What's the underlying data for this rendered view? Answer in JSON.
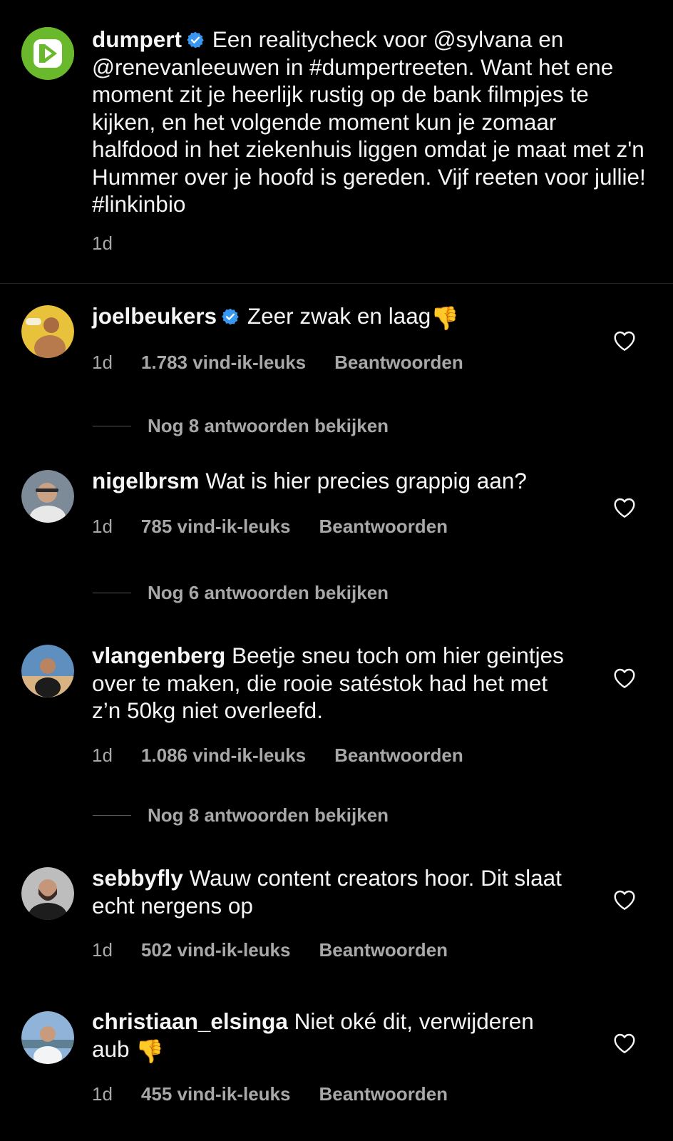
{
  "caption": {
    "username": "dumpert",
    "text": "Een realitycheck voor @sylvana en @renevanleeuwen in #dumpertreeten. Want het ene moment zit je heerlijk rustig op de bank filmpjes te kijken, en het volgende moment kun je zomaar halfdood in het ziekenhuis liggen omdat je maat met z'n Hummer over je hoofd is gereden. Vijf reeten voor jullie! #linkinbio",
    "time": "1d"
  },
  "comments": [
    {
      "username": "joelbeukers",
      "verified": true,
      "text": "Zeer zwak en laag",
      "emoji": "👎",
      "time": "1d",
      "likes": "1.783 vind-ik-leuks",
      "reply": "Beantwoorden",
      "view_replies": "Nog 8 antwoorden bekijken"
    },
    {
      "username": "nigelbrsm",
      "text": "Wat is hier precies grappig aan?",
      "time": "1d",
      "likes": "785 vind-ik-leuks",
      "reply": "Beantwoorden",
      "view_replies": "Nog 6 antwoorden bekijken"
    },
    {
      "username": "vlangenberg",
      "text": "Beetje sneu toch om hier geintjes over te maken, die rooie satéstok had het met z’n 50kg niet overleefd.",
      "time": "1d",
      "likes": "1.086 vind-ik-leuks",
      "reply": "Beantwoorden",
      "view_replies": "Nog 8 antwoorden bekijken"
    },
    {
      "username": "sebbyfly",
      "text": "Wauw content creators hoor. Dit slaat echt nergens op",
      "time": "1d",
      "likes": "502 vind-ik-leuks",
      "reply": "Beantwoorden"
    },
    {
      "username": "christiaan_elsinga",
      "text": "Niet oké dit, verwijderen aub",
      "emoji": "👎",
      "time": "1d",
      "likes": "455 vind-ik-leuks",
      "reply": "Beantwoorden"
    }
  ],
  "icons": {
    "heart": "heart-outline-icon",
    "verified": "verified-badge-icon"
  },
  "colors": {
    "background": "#000000",
    "text": "#f5f5f5",
    "secondary": "#a8a8a8",
    "verified": "#3897f0",
    "dumpert_green": "#6ab82c"
  }
}
